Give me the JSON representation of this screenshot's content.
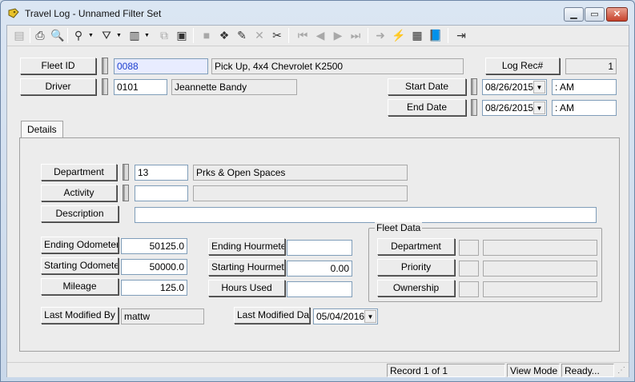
{
  "window": {
    "title": "Travel Log - Unnamed Filter Set"
  },
  "header": {
    "fleet_id_label": "Fleet ID",
    "fleet_id_value": "0088",
    "fleet_desc": "Pick Up, 4x4 Chevrolet K2500",
    "driver_label": "Driver",
    "driver_id": "0101",
    "driver_name": "Jeannette Bandy",
    "log_rec_label": "Log Rec#",
    "log_rec_value": "1",
    "start_date_label": "Start Date",
    "start_date": "08/26/2015",
    "start_time": ":  AM",
    "end_date_label": "End Date",
    "end_date": "08/26/2015",
    "end_time": ":  AM"
  },
  "tabs": [
    {
      "label": "Details"
    }
  ],
  "details": {
    "department_label": "Department",
    "department_code": "13",
    "department_desc": "Prks & Open Spaces",
    "activity_label": "Activity",
    "activity_code": "",
    "activity_desc": "",
    "description_label": "Description",
    "description_value": "",
    "ending_odometer_label": "Ending Odometer",
    "ending_odometer": "50125.0",
    "starting_odometer_label": "Starting Odometer",
    "starting_odometer": "50000.0",
    "mileage_label": "Mileage",
    "mileage": "125.0",
    "ending_hourmeter_label": "Ending Hourmeter",
    "ending_hourmeter": "",
    "starting_hourmeter_label": "Starting Hourmeter",
    "starting_hourmeter": "0.00",
    "hours_used_label": "Hours Used",
    "hours_used": "",
    "last_modified_by_label": "Last Modified By",
    "last_modified_by": "mattw",
    "last_modified_date_label": "Last Modified Date",
    "last_modified_date": "05/04/2016"
  },
  "fleet_data": {
    "title": "Fleet Data",
    "department_label": "Department",
    "priority_label": "Priority",
    "ownership_label": "Ownership"
  },
  "status": {
    "record": "Record 1 of 1",
    "mode": "View Mode",
    "state": "Ready..."
  },
  "toolbar_icons": [
    "new-icon",
    "print-icon",
    "preview-icon",
    "find-icon",
    "filter-icon",
    "report-icon",
    "copy-icon",
    "paste-icon",
    "save-icon",
    "add-icon",
    "edit-icon",
    "delete-icon",
    "cut-icon",
    "first-icon",
    "prev-icon",
    "next-icon",
    "last-icon",
    "goto-icon",
    "quick-icon",
    "list-icon",
    "book-icon",
    "exit-icon"
  ],
  "colors": {
    "title_bar": "#dbe6f3",
    "highlight_text": "#1d3fcf",
    "close_button": "#c7422b"
  }
}
